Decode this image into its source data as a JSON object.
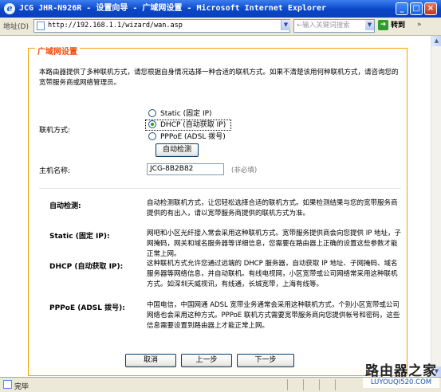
{
  "window": {
    "title": "JCG JHR-N926R - 设置向导 - 广域网设置 - Microsoft Internet Explorer",
    "min": "_",
    "max": "□",
    "close": "×"
  },
  "addressbar": {
    "label": "地址(D)",
    "url": "http://192.168.1.1/wizard/wan.asp",
    "keyword_placeholder": "←输入关键词搜索",
    "go_label": "转到",
    "links_label": "»"
  },
  "panel": {
    "title": "广域网设置",
    "intro": "本路由器提供了多种联机方式，请您根据自身情况选择一种合适的联机方式。如果不清楚该用何种联机方式，请咨询您的宽带服务商或网络管理员。",
    "connection_label": "联机方式:",
    "options": [
      {
        "label": "Static (固定 IP)",
        "selected": false
      },
      {
        "label": "DHCP (自动获取 IP)",
        "selected": true
      },
      {
        "label": "PPPoE (ADSL 拨号)",
        "selected": false
      }
    ],
    "auto_detect_button": "自动检测",
    "hostname_label": "主机名称:",
    "hostname_value": "JCG-8B2B82",
    "hostname_note": "(非必填)"
  },
  "descriptions": [
    {
      "label": "自动检测:",
      "text": "自动检测联机方式，让您轻松选择合适的联机方式。如果检测结果与您的宽带服务商提供的有出入，请以宽带服务商提供的联机方式为准。"
    },
    {
      "label": "Static (固定 IP):",
      "text": "网吧和小区光纤接入常会采用这种联机方式。宽带服务提供商会向您提供 IP 地址，子网掩码，网关和域名服务器等详细信息，您需要在路由器上正确的设置这些参数才能正常上网。"
    },
    {
      "label": "DHCP (自动获取 IP):",
      "text": "这种联机方式允许您通过远端的 DHCP 服务器，自动获取 IP 地址、子网掩码、域名服务器等网络信息，并自动联机。有线电视网，小区宽带或公司网络常采用这种联机方式。如深圳天威视讯，有线通，长城宽带，上海有线等。"
    },
    {
      "label": "PPPoE (ADSL 拨号):",
      "text": "中国电信，中国网通 ADSL 宽带业务通常会采用这种联机方式，个别小区宽带或公司网络也会采用这种方式。PPPoE 联机方式需要宽带服务商向您提供帐号和密码，这些信息需要设置到路由器上才能正常上网。"
    }
  ],
  "buttons": {
    "cancel": "取消",
    "prev": "上一步",
    "next": "下一步"
  },
  "status": {
    "text": "完毕"
  },
  "watermark": {
    "brand": "路由器之家",
    "site": "LUYOUQI520.COM"
  },
  "colors": {
    "panel_border": "#f5a000",
    "panel_title": "#f54600",
    "titlebar": "#0a46c8"
  }
}
